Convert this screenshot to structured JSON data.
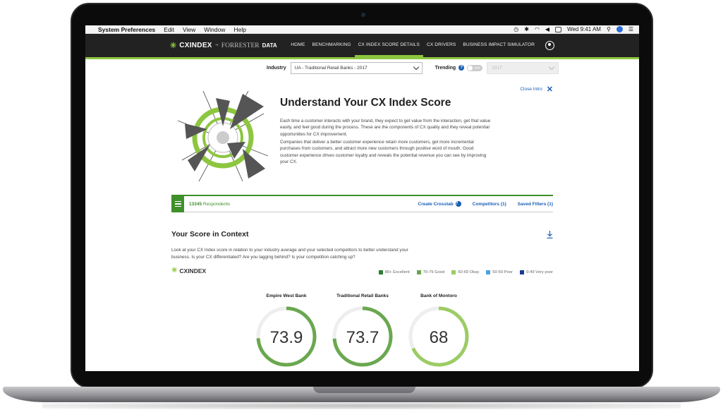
{
  "menubar": {
    "apple": "",
    "app_name": "System Preferences",
    "items": [
      "Edit",
      "View",
      "Window",
      "Help"
    ],
    "clock": "Wed 9:41 AM"
  },
  "nav": {
    "brand_cx": "CXINDEX",
    "brand_tm": "™",
    "brand_forrester": "FORRESTER",
    "brand_data": "DATA",
    "links": [
      "HOME",
      "BENCHMARKING",
      "CX INDEX SCORE DETAILS",
      "CX DRIVERS",
      "BUSINESS IMPACT SIMULATOR"
    ],
    "active_index": 2
  },
  "filters": {
    "industry_label": "Industry",
    "industry_value": "UA - Traditional Retail Banks - 2017",
    "trending_label": "Trending",
    "help_glyph": "?",
    "toggle_text": "OFF",
    "year_value": "2017"
  },
  "intro": {
    "close_label": "Close Intro",
    "close_glyph": "✕",
    "title": "Understand Your CX Index Score",
    "p1": "Each time a customer interacts with your brand, they expect to get value from the interaction, get that value easily, and feel good during the process. These are the components of CX quality and they reveal potential opportunities for CX improvement.",
    "p2": "Companies that deliver a better customer experience retain more customers, get more incremental purchases from customers, and attract more new customers through positive word of mouth. Good customer experience drives customer loyalty and reveals the potential revenue you can see by improving your CX."
  },
  "respondents": {
    "count": "13345",
    "label": "Respondents",
    "actions": [
      "Create Crosstab",
      "Competitors (1)",
      "Saved Filters (1)"
    ]
  },
  "context": {
    "title": "Your Score in Context",
    "description": "Look at your CX Index score in relation to your industry average and your selected competitors to better understand your business. Is your CX differentiated? Are you lagging behind? Is your competition catching up?",
    "logo_text": "CXINDEX",
    "legend": [
      {
        "label": "80+ Excellent",
        "color": "#2e7d32"
      },
      {
        "label": "70-79 Good",
        "color": "#6aa84f"
      },
      {
        "label": "60-69 Okay",
        "color": "#9ccc65"
      },
      {
        "label": "50-59 Poor",
        "color": "#4aa3df"
      },
      {
        "label": "0-49 Very poor",
        "color": "#1a3a8f"
      }
    ]
  },
  "scores": [
    {
      "name": "Empire West Bank",
      "value": "73.9",
      "fraction": 0.739,
      "color": "#6aa84f"
    },
    {
      "name": "Traditional Retail Banks",
      "value": "73.7",
      "fraction": 0.737,
      "color": "#6aa84f"
    },
    {
      "name": "Bank of Montoro",
      "value": "68",
      "fraction": 0.68,
      "color": "#9ccc65"
    }
  ]
}
